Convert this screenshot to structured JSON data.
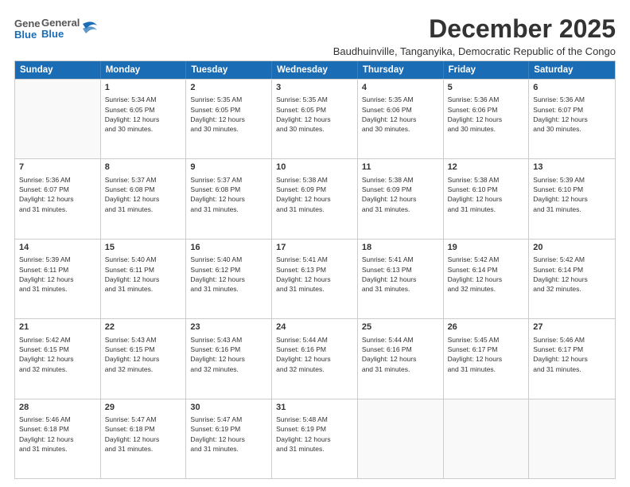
{
  "logo": {
    "general": "General",
    "blue": "Blue"
  },
  "title": "December 2025",
  "subtitle": "Baudhuinville, Tanganyika, Democratic Republic of the Congo",
  "header_days": [
    "Sunday",
    "Monday",
    "Tuesday",
    "Wednesday",
    "Thursday",
    "Friday",
    "Saturday"
  ],
  "rows": [
    [
      {
        "num": "",
        "lines": []
      },
      {
        "num": "1",
        "lines": [
          "Sunrise: 5:34 AM",
          "Sunset: 6:05 PM",
          "Daylight: 12 hours",
          "and 30 minutes."
        ]
      },
      {
        "num": "2",
        "lines": [
          "Sunrise: 5:35 AM",
          "Sunset: 6:05 PM",
          "Daylight: 12 hours",
          "and 30 minutes."
        ]
      },
      {
        "num": "3",
        "lines": [
          "Sunrise: 5:35 AM",
          "Sunset: 6:05 PM",
          "Daylight: 12 hours",
          "and 30 minutes."
        ]
      },
      {
        "num": "4",
        "lines": [
          "Sunrise: 5:35 AM",
          "Sunset: 6:06 PM",
          "Daylight: 12 hours",
          "and 30 minutes."
        ]
      },
      {
        "num": "5",
        "lines": [
          "Sunrise: 5:36 AM",
          "Sunset: 6:06 PM",
          "Daylight: 12 hours",
          "and 30 minutes."
        ]
      },
      {
        "num": "6",
        "lines": [
          "Sunrise: 5:36 AM",
          "Sunset: 6:07 PM",
          "Daylight: 12 hours",
          "and 30 minutes."
        ]
      }
    ],
    [
      {
        "num": "7",
        "lines": [
          "Sunrise: 5:36 AM",
          "Sunset: 6:07 PM",
          "Daylight: 12 hours",
          "and 31 minutes."
        ]
      },
      {
        "num": "8",
        "lines": [
          "Sunrise: 5:37 AM",
          "Sunset: 6:08 PM",
          "Daylight: 12 hours",
          "and 31 minutes."
        ]
      },
      {
        "num": "9",
        "lines": [
          "Sunrise: 5:37 AM",
          "Sunset: 6:08 PM",
          "Daylight: 12 hours",
          "and 31 minutes."
        ]
      },
      {
        "num": "10",
        "lines": [
          "Sunrise: 5:38 AM",
          "Sunset: 6:09 PM",
          "Daylight: 12 hours",
          "and 31 minutes."
        ]
      },
      {
        "num": "11",
        "lines": [
          "Sunrise: 5:38 AM",
          "Sunset: 6:09 PM",
          "Daylight: 12 hours",
          "and 31 minutes."
        ]
      },
      {
        "num": "12",
        "lines": [
          "Sunrise: 5:38 AM",
          "Sunset: 6:10 PM",
          "Daylight: 12 hours",
          "and 31 minutes."
        ]
      },
      {
        "num": "13",
        "lines": [
          "Sunrise: 5:39 AM",
          "Sunset: 6:10 PM",
          "Daylight: 12 hours",
          "and 31 minutes."
        ]
      }
    ],
    [
      {
        "num": "14",
        "lines": [
          "Sunrise: 5:39 AM",
          "Sunset: 6:11 PM",
          "Daylight: 12 hours",
          "and 31 minutes."
        ]
      },
      {
        "num": "15",
        "lines": [
          "Sunrise: 5:40 AM",
          "Sunset: 6:11 PM",
          "Daylight: 12 hours",
          "and 31 minutes."
        ]
      },
      {
        "num": "16",
        "lines": [
          "Sunrise: 5:40 AM",
          "Sunset: 6:12 PM",
          "Daylight: 12 hours",
          "and 31 minutes."
        ]
      },
      {
        "num": "17",
        "lines": [
          "Sunrise: 5:41 AM",
          "Sunset: 6:13 PM",
          "Daylight: 12 hours",
          "and 31 minutes."
        ]
      },
      {
        "num": "18",
        "lines": [
          "Sunrise: 5:41 AM",
          "Sunset: 6:13 PM",
          "Daylight: 12 hours",
          "and 31 minutes."
        ]
      },
      {
        "num": "19",
        "lines": [
          "Sunrise: 5:42 AM",
          "Sunset: 6:14 PM",
          "Daylight: 12 hours",
          "and 32 minutes."
        ]
      },
      {
        "num": "20",
        "lines": [
          "Sunrise: 5:42 AM",
          "Sunset: 6:14 PM",
          "Daylight: 12 hours",
          "and 32 minutes."
        ]
      }
    ],
    [
      {
        "num": "21",
        "lines": [
          "Sunrise: 5:42 AM",
          "Sunset: 6:15 PM",
          "Daylight: 12 hours",
          "and 32 minutes."
        ]
      },
      {
        "num": "22",
        "lines": [
          "Sunrise: 5:43 AM",
          "Sunset: 6:15 PM",
          "Daylight: 12 hours",
          "and 32 minutes."
        ]
      },
      {
        "num": "23",
        "lines": [
          "Sunrise: 5:43 AM",
          "Sunset: 6:16 PM",
          "Daylight: 12 hours",
          "and 32 minutes."
        ]
      },
      {
        "num": "24",
        "lines": [
          "Sunrise: 5:44 AM",
          "Sunset: 6:16 PM",
          "Daylight: 12 hours",
          "and 32 minutes."
        ]
      },
      {
        "num": "25",
        "lines": [
          "Sunrise: 5:44 AM",
          "Sunset: 6:16 PM",
          "Daylight: 12 hours",
          "and 31 minutes."
        ]
      },
      {
        "num": "26",
        "lines": [
          "Sunrise: 5:45 AM",
          "Sunset: 6:17 PM",
          "Daylight: 12 hours",
          "and 31 minutes."
        ]
      },
      {
        "num": "27",
        "lines": [
          "Sunrise: 5:46 AM",
          "Sunset: 6:17 PM",
          "Daylight: 12 hours",
          "and 31 minutes."
        ]
      }
    ],
    [
      {
        "num": "28",
        "lines": [
          "Sunrise: 5:46 AM",
          "Sunset: 6:18 PM",
          "Daylight: 12 hours",
          "and 31 minutes."
        ]
      },
      {
        "num": "29",
        "lines": [
          "Sunrise: 5:47 AM",
          "Sunset: 6:18 PM",
          "Daylight: 12 hours",
          "and 31 minutes."
        ]
      },
      {
        "num": "30",
        "lines": [
          "Sunrise: 5:47 AM",
          "Sunset: 6:19 PM",
          "Daylight: 12 hours",
          "and 31 minutes."
        ]
      },
      {
        "num": "31",
        "lines": [
          "Sunrise: 5:48 AM",
          "Sunset: 6:19 PM",
          "Daylight: 12 hours",
          "and 31 minutes."
        ]
      },
      {
        "num": "",
        "lines": []
      },
      {
        "num": "",
        "lines": []
      },
      {
        "num": "",
        "lines": []
      }
    ]
  ]
}
